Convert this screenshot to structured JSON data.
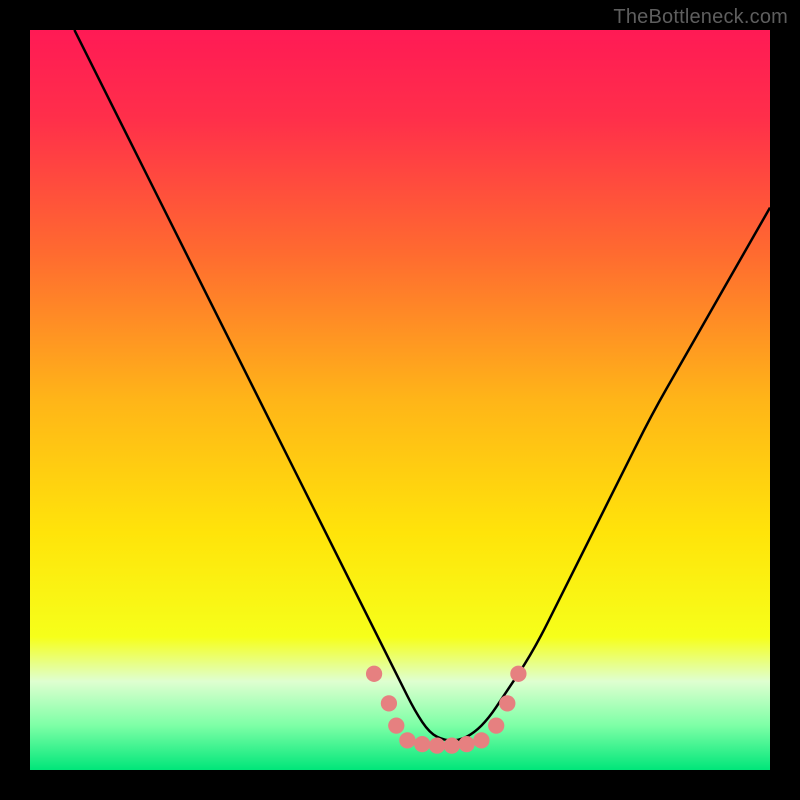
{
  "watermark": "TheBottleneck.com",
  "chart_data": {
    "type": "line",
    "title": "",
    "xlabel": "",
    "ylabel": "",
    "xlim": [
      0,
      100
    ],
    "ylim": [
      0,
      100
    ],
    "x_axis_visible": false,
    "y_axis_visible": false,
    "grid": false,
    "background_gradient_stops": [
      {
        "offset": 0.0,
        "color": "#ff1a55"
      },
      {
        "offset": 0.12,
        "color": "#ff2f4a"
      },
      {
        "offset": 0.3,
        "color": "#ff6a30"
      },
      {
        "offset": 0.5,
        "color": "#ffb518"
      },
      {
        "offset": 0.68,
        "color": "#ffe40a"
      },
      {
        "offset": 0.82,
        "color": "#f6ff1a"
      },
      {
        "offset": 0.88,
        "color": "#dfffd0"
      },
      {
        "offset": 0.94,
        "color": "#7dffa6"
      },
      {
        "offset": 1.0,
        "color": "#00e67a"
      }
    ],
    "series": [
      {
        "name": "bottleneck-curve",
        "color": "#000000",
        "x": [
          6,
          10,
          14,
          18,
          22,
          26,
          30,
          34,
          38,
          42,
          46,
          48,
          50,
          52,
          54,
          56,
          58,
          60,
          62,
          64,
          68,
          72,
          76,
          80,
          84,
          88,
          92,
          96,
          100
        ],
        "values": [
          100,
          92,
          84,
          76,
          68,
          60,
          52,
          44,
          36,
          28,
          20,
          16,
          12,
          8,
          5,
          4,
          4,
          5,
          7,
          10,
          16,
          24,
          32,
          40,
          48,
          55,
          62,
          69,
          76
        ]
      }
    ],
    "markers": {
      "name": "trough-markers",
      "color": "#e68080",
      "radius_percent": 1.1,
      "points": [
        {
          "x": 46.5,
          "y": 13.0
        },
        {
          "x": 48.5,
          "y": 9.0
        },
        {
          "x": 49.5,
          "y": 6.0
        },
        {
          "x": 51.0,
          "y": 4.0
        },
        {
          "x": 53.0,
          "y": 3.5
        },
        {
          "x": 55.0,
          "y": 3.3
        },
        {
          "x": 57.0,
          "y": 3.3
        },
        {
          "x": 59.0,
          "y": 3.5
        },
        {
          "x": 61.0,
          "y": 4.0
        },
        {
          "x": 63.0,
          "y": 6.0
        },
        {
          "x": 64.5,
          "y": 9.0
        },
        {
          "x": 66.0,
          "y": 13.0
        }
      ]
    }
  }
}
